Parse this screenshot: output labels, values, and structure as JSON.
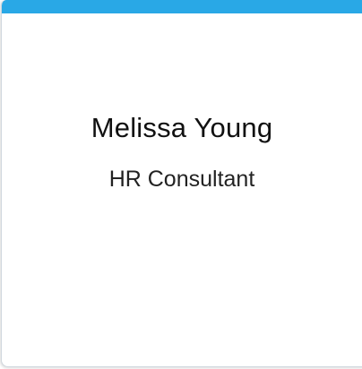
{
  "card": {
    "accent_color": "#29a8e6",
    "name": "Melissa Young",
    "title": "HR Consultant"
  }
}
